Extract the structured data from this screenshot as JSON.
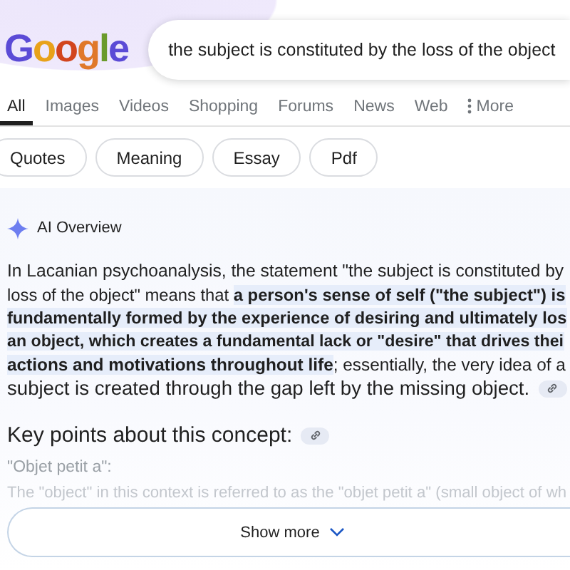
{
  "logo": {
    "text": "Google"
  },
  "search": {
    "value": "the subject is constituted by the loss of the object"
  },
  "tabs": [
    {
      "label": "All",
      "selected": true
    },
    {
      "label": "Images",
      "selected": false
    },
    {
      "label": "Videos",
      "selected": false
    },
    {
      "label": "Shopping",
      "selected": false
    },
    {
      "label": "Forums",
      "selected": false
    },
    {
      "label": "News",
      "selected": false
    },
    {
      "label": "Web",
      "selected": false
    },
    {
      "label": "More",
      "selected": false,
      "kind": "menu"
    }
  ],
  "chips": [
    "Quotes",
    "Meaning",
    "Essay",
    "Pdf"
  ],
  "ai_overview": {
    "title": "AI Overview",
    "lines": [
      "In Lacanian psychoanalysis, the statement \"the subject is constituted by",
      "loss of the object\" means that **a person's sense of self (\"the subject\") is**",
      "**fundamentally formed by the experience of desiring and ultimately los**",
      "**an object, which creates a fundamental lack or \"desire\" that drives thei**",
      "**actions and motivations throughout life**; essentially, the very idea of a",
      "subject is created through the gap left by the missing object."
    ],
    "heading": "Key points about this concept:",
    "subheading": "\"Objet petit a\":",
    "faded_line": "The \"object\" in this context is referred to as the \"objet petit a\" (small object of wh",
    "show_more": "Show more"
  }
}
